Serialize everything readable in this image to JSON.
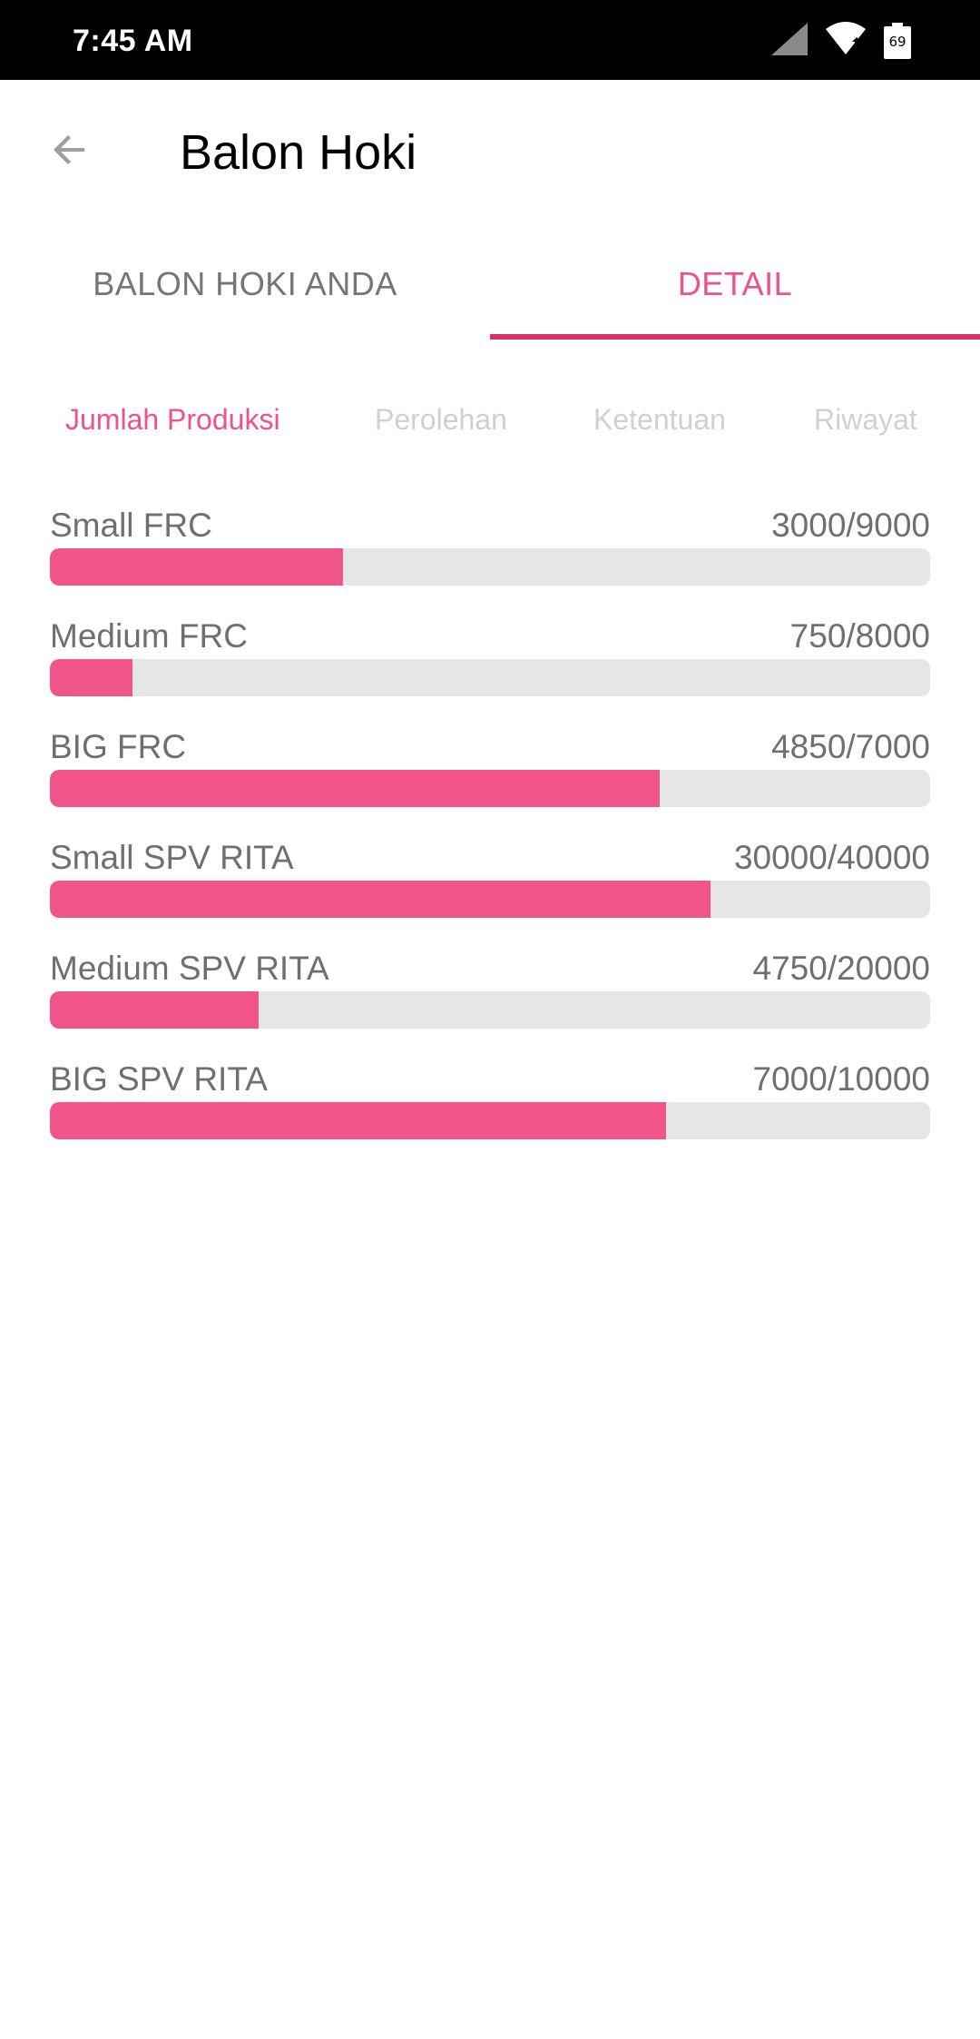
{
  "status_bar": {
    "time": "7:45 AM",
    "battery_level": "69",
    "icons": [
      "signal-icon",
      "wifi-icon",
      "battery-icon"
    ]
  },
  "app_bar": {
    "title": "Balon Hoki",
    "back_icon": "arrow-back-icon"
  },
  "tabs": [
    {
      "label": "BALON HOKI ANDA",
      "active": false
    },
    {
      "label": "DETAIL",
      "active": true
    }
  ],
  "subtabs": [
    {
      "label": "Jumlah Produksi",
      "active": true
    },
    {
      "label": "Perolehan",
      "active": false
    },
    {
      "label": "Ketentuan",
      "active": false
    },
    {
      "label": "Riwayat",
      "active": false
    }
  ],
  "progress_items": [
    {
      "label": "Small FRC",
      "value_text": "3000/9000",
      "current": 3000,
      "target": 9000
    },
    {
      "label": "Medium FRC",
      "value_text": "750/8000",
      "current": 750,
      "target": 8000
    },
    {
      "label": "BIG FRC",
      "value_text": "4850/7000",
      "current": 4850,
      "target": 7000
    },
    {
      "label": "Small SPV RITA",
      "value_text": "30000/40000",
      "current": 30000,
      "target": 40000
    },
    {
      "label": "Medium SPV RITA",
      "value_text": "4750/20000",
      "current": 4750,
      "target": 20000
    },
    {
      "label": "BIG SPV RITA",
      "value_text": "7000/10000",
      "current": 7000,
      "target": 10000
    }
  ],
  "colors": {
    "accent": "#ef5289",
    "indicator": "#d8306c",
    "bar_fill": "#f0548a",
    "bar_track": "#e6e6e6",
    "text_secondary": "#6f6f6f"
  }
}
